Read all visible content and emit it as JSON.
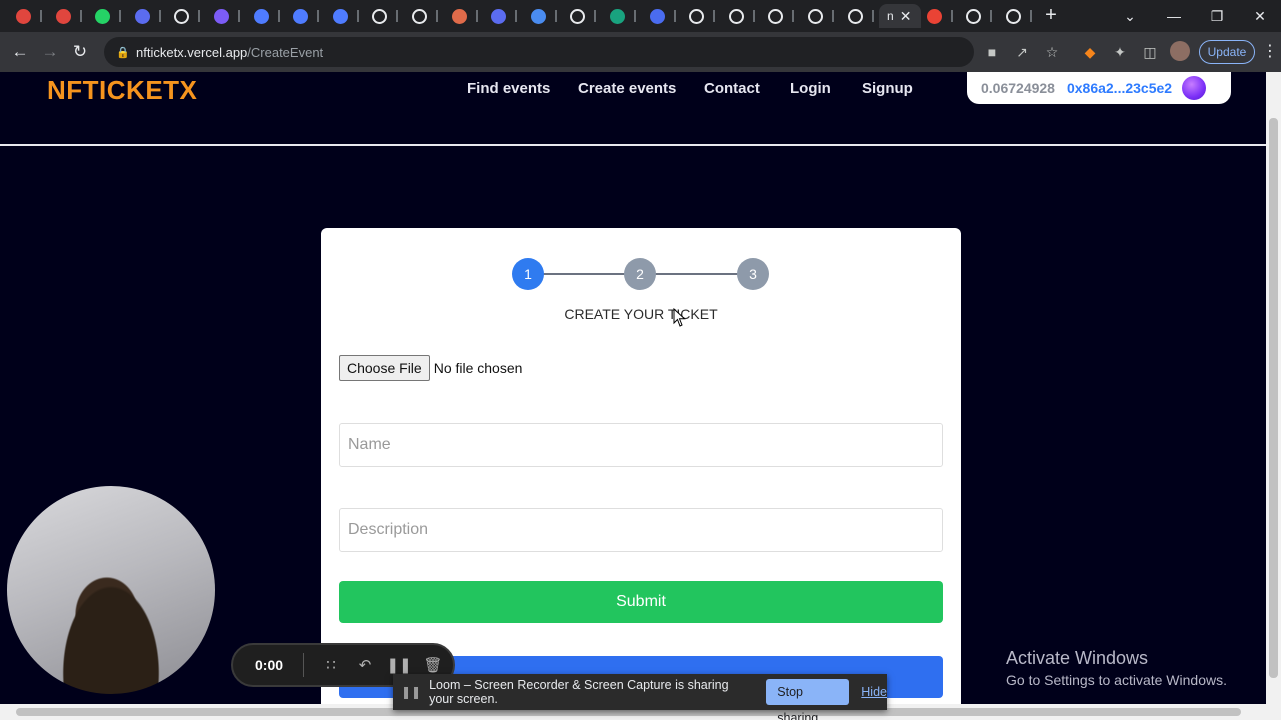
{
  "browser": {
    "url_host": "nfticketx.vercel.app",
    "url_path": "/CreateEvent",
    "update_label": "Update",
    "tab_icons": [
      {
        "name": "record-icon",
        "color": "#e0463e"
      },
      {
        "name": "record-icon",
        "color": "#e0463e"
      },
      {
        "name": "whatsapp-icon",
        "color": "#25d366"
      },
      {
        "name": "gear-icon",
        "color": "#5b6cf0"
      },
      {
        "name": "github-icon",
        "color": "#e8eaed"
      },
      {
        "name": "app-icon",
        "color": "#7c5cf6"
      },
      {
        "name": "app-icon",
        "color": "#4f7cff"
      },
      {
        "name": "app-icon",
        "color": "#4f7cff"
      },
      {
        "name": "app-icon",
        "color": "#4f7cff"
      },
      {
        "name": "x-icon",
        "color": "#e8eaed"
      },
      {
        "name": "triangle-icon",
        "color": "#e8eaed"
      },
      {
        "name": "app-icon",
        "color": "#e06b4a"
      },
      {
        "name": "gear-icon",
        "color": "#5b6cf0"
      },
      {
        "name": "app-icon",
        "color": "#4a8cf0"
      },
      {
        "name": "github-icon",
        "color": "#e8eaed"
      },
      {
        "name": "app-icon",
        "color": "#19a37f"
      },
      {
        "name": "app-icon",
        "color": "#4a6cf0"
      },
      {
        "name": "google-icon",
        "color": "#e8eaed"
      },
      {
        "name": "triangle-icon",
        "color": "#e8eaed"
      },
      {
        "name": "github-icon",
        "color": "#e8eaed"
      },
      {
        "name": "github-icon",
        "color": "#e8eaed"
      },
      {
        "name": "triangle-icon",
        "color": "#e8eaed"
      },
      {
        "name": "active-tab",
        "color": "#e8eaed"
      },
      {
        "name": "gmail-icon",
        "color": "#ea4335"
      },
      {
        "name": "google-icon",
        "color": "#e8eaed"
      },
      {
        "name": "triangle-icon",
        "color": "#e8eaed"
      }
    ],
    "active_tab_letter": "n"
  },
  "site": {
    "logo": "NFTICKETX",
    "nav": [
      "Find events",
      "Create events",
      "Contact",
      "Login",
      "Signup"
    ],
    "wallet_balance": "0.06724928",
    "wallet_address": "0x86a2...23c5e2"
  },
  "form": {
    "steps": [
      "1",
      "2",
      "3"
    ],
    "active_step": 1,
    "step_title": "CREATE YOUR TICKET",
    "file_button": "Choose File",
    "file_status": "No file chosen",
    "name_placeholder": "Name",
    "description_placeholder": "Description",
    "submit_label": "Submit"
  },
  "os_watermark": {
    "line1": "Activate Windows",
    "line2": "Go to Settings to activate Windows."
  },
  "loom": {
    "timer": "0:00",
    "share_message": "Loom – Screen Recorder & Screen Capture is sharing your screen.",
    "stop_label": "Stop sharing",
    "hide_label": "Hide"
  },
  "colors": {
    "page_bg": "#00001a",
    "logo": "#f5941e",
    "accent_blue": "#2f7bf0",
    "submit_green": "#22c55e"
  }
}
